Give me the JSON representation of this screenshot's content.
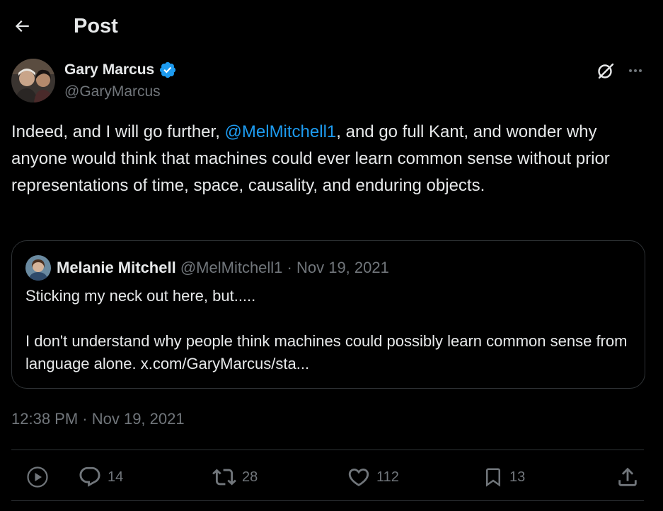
{
  "header": {
    "back_icon": "arrow-left-icon",
    "title": "Post"
  },
  "author": {
    "name": "Gary Marcus",
    "handle": "@GaryMarcus",
    "verified": true,
    "verified_color": "#1d9bf0"
  },
  "tweet": {
    "text_before": "Indeed, and I will go further, ",
    "mention": "@MelMitchell1",
    "text_after": ", and go full Kant, and wonder why anyone would think that machines could ever learn common sense without prior representations of time, space, causality, and enduring objects.",
    "timestamp": "12:38 PM · Nov 19, 2021"
  },
  "quote": {
    "name": "Melanie Mitchell",
    "meta": " @MelMitchell1 · Nov 19, 2021",
    "line1": "Sticking my neck out here, but.....",
    "line2": "I don't understand why people think machines could possibly learn common sense from language alone. x.com/GaryMarcus/sta..."
  },
  "actions": {
    "view_icon": "play-circle-icon",
    "replies": "14",
    "reposts": "28",
    "likes": "112",
    "bookmarks": "13",
    "share_icon": "share-icon"
  },
  "colors": {
    "background": "#000000",
    "text": "#e7e9ea",
    "muted": "#71767b",
    "accent": "#1d9bf0",
    "border": "#2f3336"
  }
}
